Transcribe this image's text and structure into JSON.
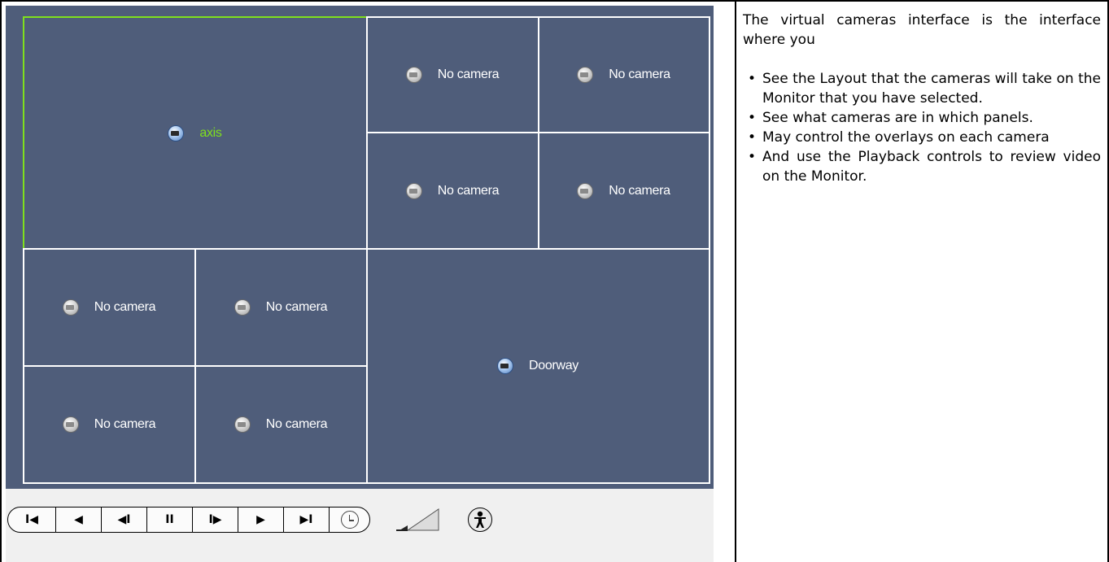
{
  "cameras": {
    "axis": "axis",
    "no_camera": "No camera",
    "doorway": "Doorway"
  },
  "playback": {
    "first": "I◀",
    "prev": "◀",
    "step_back": "◀I",
    "pause": "II",
    "step_forward": "I▶",
    "play": "▶",
    "last": "▶I"
  },
  "description": {
    "intro": "The virtual cameras interface is the interface where you",
    "bullets": [
      "See the Layout that the cameras will take on the Monitor that you have selected.",
      "See what cameras are in which panels.",
      "May control the overlays on each camera",
      "And use the Playback controls to review video on the Monitor."
    ]
  },
  "colors": {
    "grid_background": "#4f5d7a",
    "panel_border": "#ffffff",
    "selected_border": "#7fe01d"
  }
}
